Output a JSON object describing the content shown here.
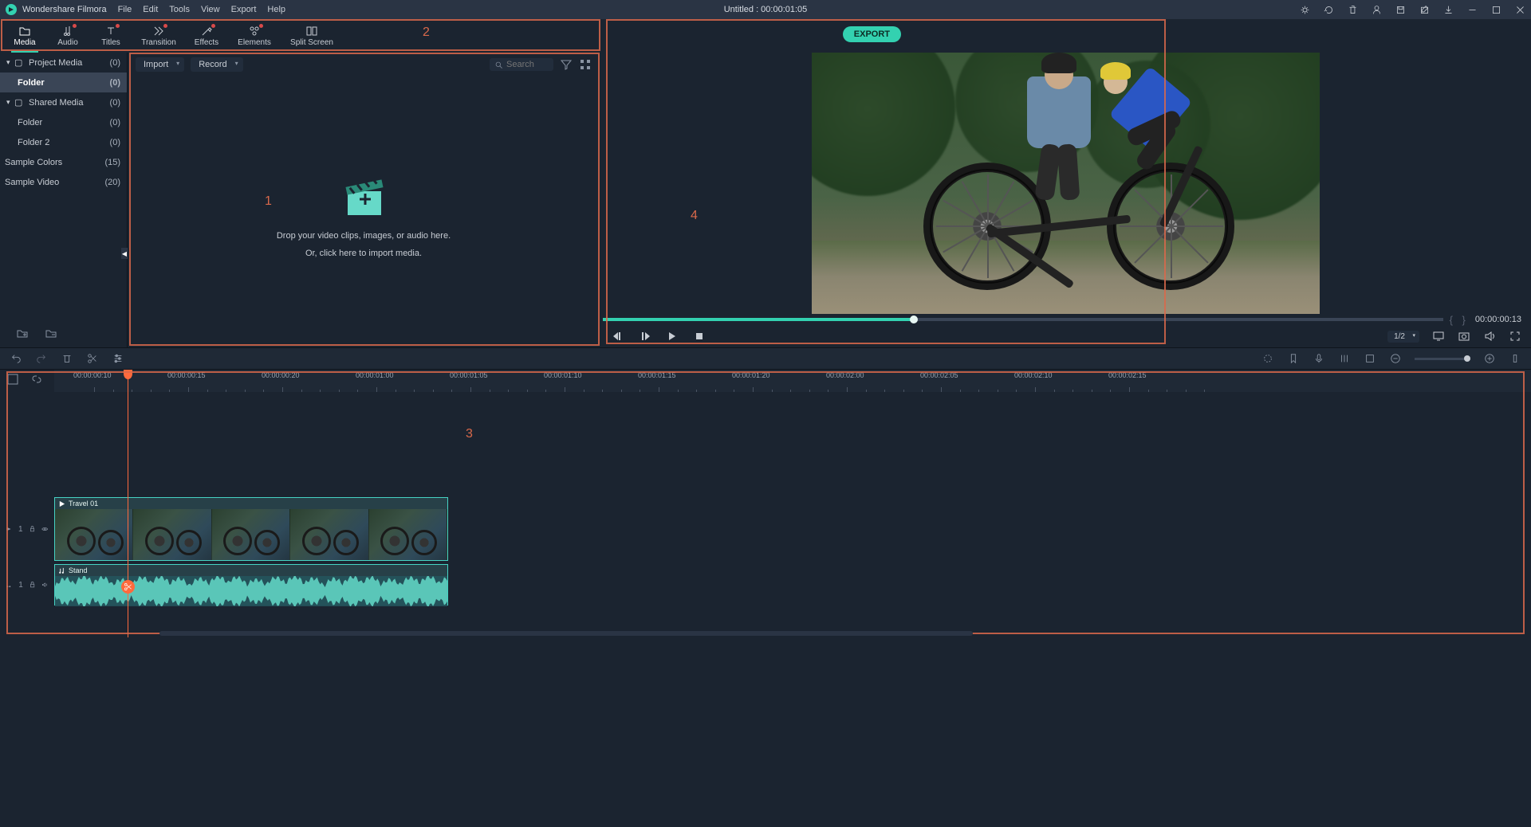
{
  "titlebar": {
    "app_name": "Wondershare Filmora",
    "menus": [
      "File",
      "Edit",
      "Tools",
      "View",
      "Export",
      "Help"
    ],
    "doc_title": "Untitled : 00:00:01:05"
  },
  "tool_tabs": [
    {
      "label": "Media",
      "active": true,
      "dot": false
    },
    {
      "label": "Audio",
      "dot": true
    },
    {
      "label": "Titles",
      "dot": true
    },
    {
      "label": "Transition",
      "dot": true
    },
    {
      "label": "Effects",
      "dot": true
    },
    {
      "label": "Elements",
      "dot": true
    },
    {
      "label": "Split Screen",
      "dot": false
    }
  ],
  "export_label": "EXPORT",
  "sidebar": {
    "items": [
      {
        "label": "Project Media",
        "count": "(0)",
        "expandable": true
      },
      {
        "label": "Folder",
        "count": "(0)",
        "selected": true,
        "indent": true
      },
      {
        "label": "Shared Media",
        "count": "(0)",
        "expandable": true
      },
      {
        "label": "Folder",
        "count": "(0)",
        "indent": true
      },
      {
        "label": "Folder 2",
        "count": "(0)",
        "indent": true
      },
      {
        "label": "Sample Colors",
        "count": "(15)"
      },
      {
        "label": "Sample Video",
        "count": "(20)"
      }
    ]
  },
  "media_panel": {
    "import_label": "Import",
    "record_label": "Record",
    "search_placeholder": "Search",
    "drop_line1": "Drop your video clips, images, or audio here.",
    "drop_line2": "Or, click here to import media."
  },
  "preview": {
    "timecode": "00:00:00:13",
    "ratio": "1/2"
  },
  "timeline": {
    "ruler": [
      "00:00:00:10",
      "00:00:00:15",
      "00:00:00:20",
      "00:00:01:00",
      "00:00:01:05",
      "00:00:01:10",
      "00:00:01:15",
      "00:00:01:20",
      "00:00:02:00",
      "00:00:02:05",
      "00:00:02:10",
      "00:00:02:15"
    ],
    "video_clip": "Travel 01",
    "audio_clip": "Stand",
    "video_track": "1",
    "audio_track": "1"
  },
  "annotations": {
    "n1": "1",
    "n2": "2",
    "n3": "3",
    "n4": "4"
  }
}
